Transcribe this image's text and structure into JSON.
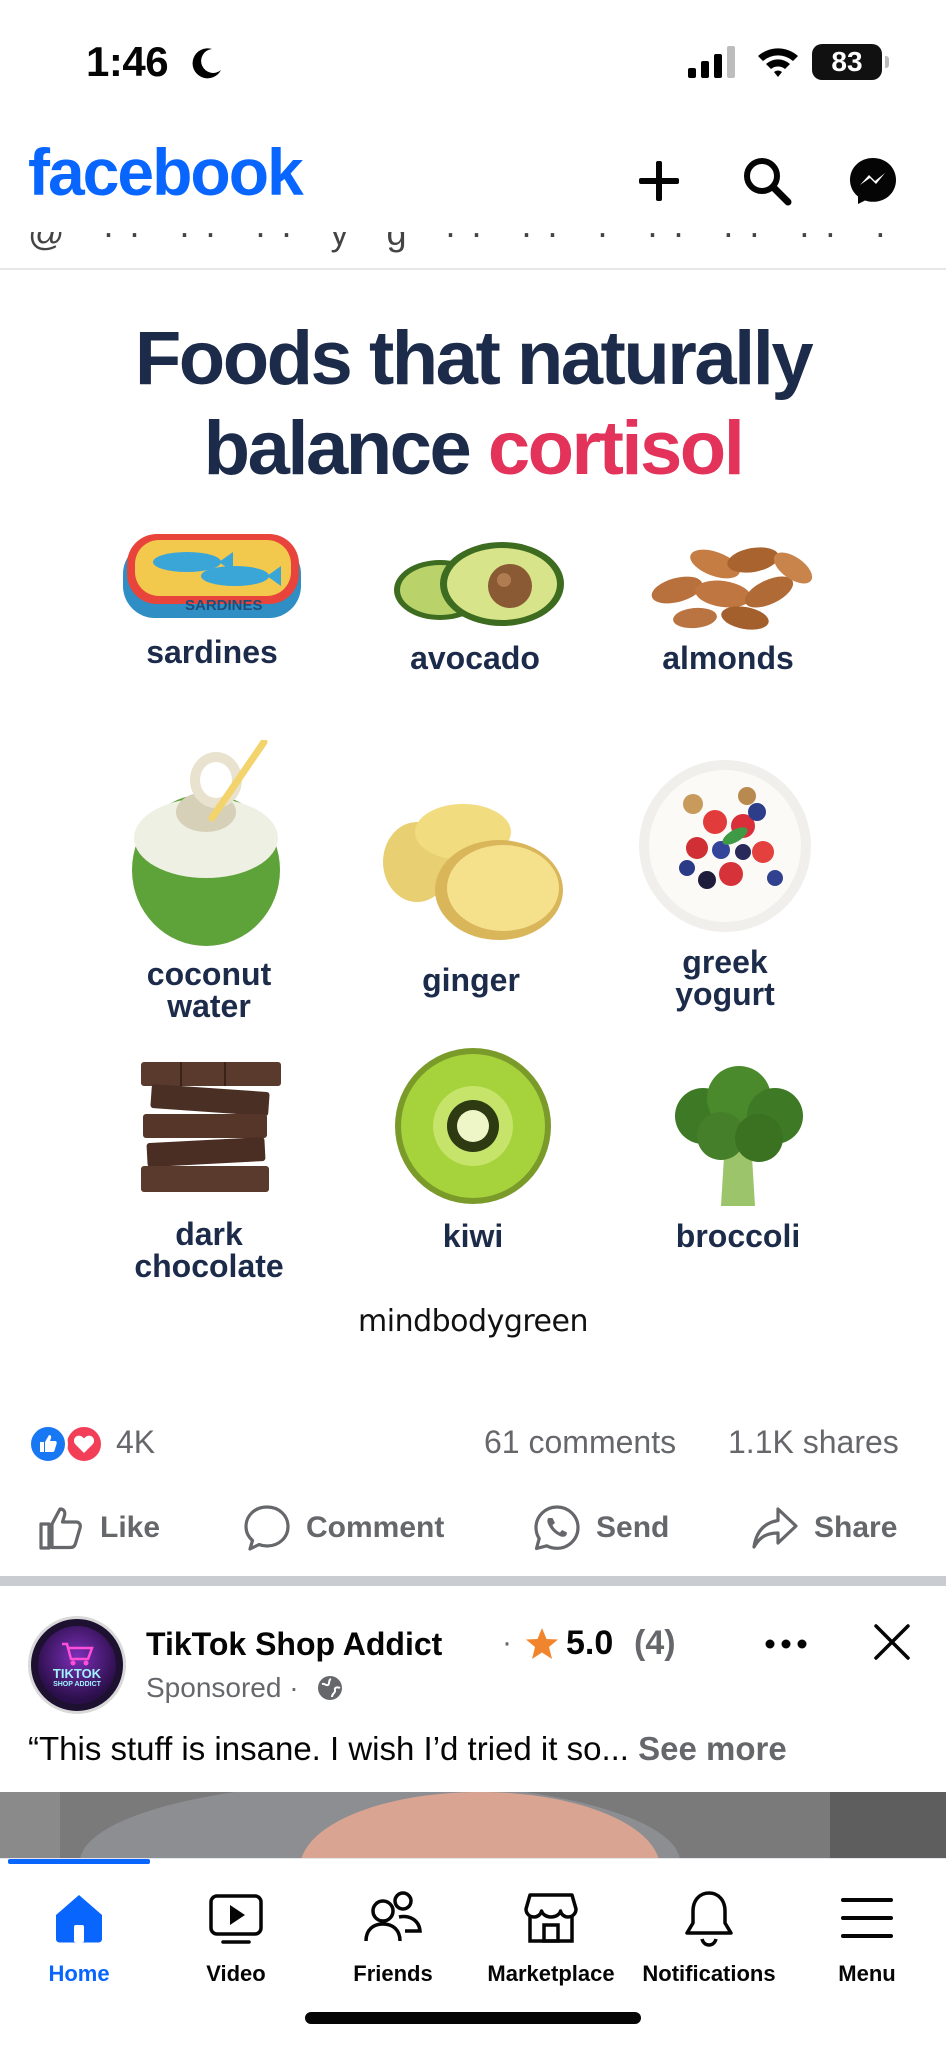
{
  "status_bar": {
    "time": "1:46",
    "battery": "83"
  },
  "header": {
    "logo": "facebook",
    "icons": [
      "plus-icon",
      "search-icon",
      "messenger-icon"
    ],
    "clipped_text": "@ ·· ·· ·· y g ·· ·· · ·· ·· ·· ·"
  },
  "post": {
    "image": {
      "title_line1": "Foods that naturally",
      "title_line2_prefix": "balance ",
      "title_line2_accent": "cortisol",
      "accent_color": "#e3335a",
      "foods": [
        {
          "label": "sardines",
          "icon": "sardines-can"
        },
        {
          "label": "avocado",
          "icon": "avocado"
        },
        {
          "label": "almonds",
          "icon": "almonds"
        },
        {
          "label_line1": "coconut",
          "label_line2": "water",
          "icon": "coconut"
        },
        {
          "label": "ginger",
          "icon": "ginger"
        },
        {
          "label_line1": "greek",
          "label_line2": "yogurt",
          "icon": "yogurt-bowl"
        },
        {
          "label_line1": "dark",
          "label_line2": "chocolate",
          "icon": "chocolate-stack"
        },
        {
          "label": "kiwi",
          "icon": "kiwi"
        },
        {
          "label": "broccoli",
          "icon": "broccoli"
        }
      ],
      "sardine_can_text": "SARDINES",
      "brand": "mindbodygreen"
    },
    "reactions_count": "4K",
    "comments": "61 comments",
    "shares": "1.1K shares",
    "actions": {
      "like": "Like",
      "comment": "Comment",
      "send": "Send",
      "share": "Share"
    }
  },
  "sponsored_post": {
    "page_name": "TikTok Shop Addict",
    "separator": "·",
    "rating": "5.0",
    "rating_count": "(4)",
    "sponsored_label": "Sponsored ·",
    "avatar_text_line1": "TIKTOK",
    "avatar_text_line2": "SHOP ADDICT",
    "caption": "“This stuff is insane. I wish I’d tried it so...",
    "see_more": "See more"
  },
  "bottom_nav": {
    "items": [
      {
        "label": "Home",
        "icon": "home-icon",
        "active": true
      },
      {
        "label": "Video",
        "icon": "video-icon"
      },
      {
        "label": "Friends",
        "icon": "friends-icon"
      },
      {
        "label": "Marketplace",
        "icon": "marketplace-icon"
      },
      {
        "label": "Notifications",
        "icon": "bell-icon"
      },
      {
        "label": "Menu",
        "icon": "menu-icon"
      }
    ]
  },
  "colors": {
    "facebook_blue": "#0866ff",
    "title_navy": "#1c2b4a",
    "secondary_text": "#65676b"
  }
}
